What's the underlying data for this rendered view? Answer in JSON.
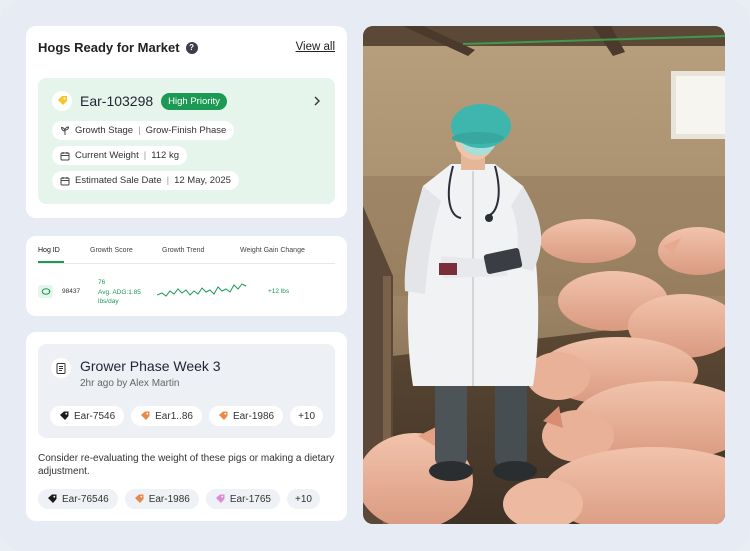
{
  "market": {
    "title": "Hogs Ready for Market",
    "view_all": "View all",
    "hog": {
      "ear_id": "Ear-103298",
      "priority": "High Priority",
      "growth_stage_label": "Growth Stage",
      "growth_stage_value": "Grow-Finish Phase",
      "current_weight_label": "Current Weight",
      "current_weight_value": "112 kg",
      "sale_date_label": "Estimated Sale Date",
      "sale_date_value": "12 May, 2025"
    }
  },
  "growth_table": {
    "headers": [
      "Hog ID",
      "Growth Score",
      "Growth Trend",
      "Weight Gain Change"
    ],
    "row": {
      "hog_id": "98437",
      "score": "76",
      "adg_line1": "Avg. ADG:1.85",
      "adg_line2": "lbs/day",
      "gain": "+12 lbs"
    }
  },
  "phase": {
    "title": "Grower Phase Week 3",
    "subtitle": "2hr ago by Alex Martin",
    "tags": [
      {
        "label": "Ear-7546",
        "color": "#1b1b1b"
      },
      {
        "label": "Ear1..86",
        "color": "#e8894a"
      },
      {
        "label": "Ear-1986",
        "color": "#e8894a"
      }
    ],
    "more": "+10",
    "note": "Consider re-evaluating the weight of these pigs or making a dietary adjustment.",
    "tags2": [
      {
        "label": "Ear-76546",
        "color": "#1b1b1b"
      },
      {
        "label": "Ear-1986",
        "color": "#e8894a"
      },
      {
        "label": "Ear-1765",
        "color": "#e08ad8"
      }
    ],
    "more2": "+10"
  },
  "colors": {
    "accent_green": "#1c9a55",
    "panel_green": "#e6f5ec",
    "tag_yellow": "#f6c52a"
  }
}
